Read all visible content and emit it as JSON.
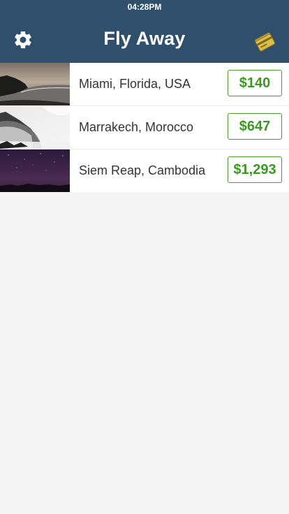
{
  "status_bar": {
    "time": "04:28PM"
  },
  "nav": {
    "title": "Fly Away",
    "settings_icon": "gear-icon",
    "cards_icon": "credit-card-icon",
    "cards_icon_color": "#d9b83a"
  },
  "colors": {
    "header": "#2f4f6d",
    "price_accent": "#3a9a1f",
    "background": "#f5f5f5"
  },
  "destinations": [
    {
      "name": "Miami, Florida, USA",
      "price": "$140",
      "image": "coast-sunset-photo"
    },
    {
      "name": "Marrakech, Morocco",
      "price": "$647",
      "image": "misty-mountain-photo"
    },
    {
      "name": "Siem Reap, Cambodia",
      "price": "$1,293",
      "image": "night-sky-photo"
    }
  ]
}
